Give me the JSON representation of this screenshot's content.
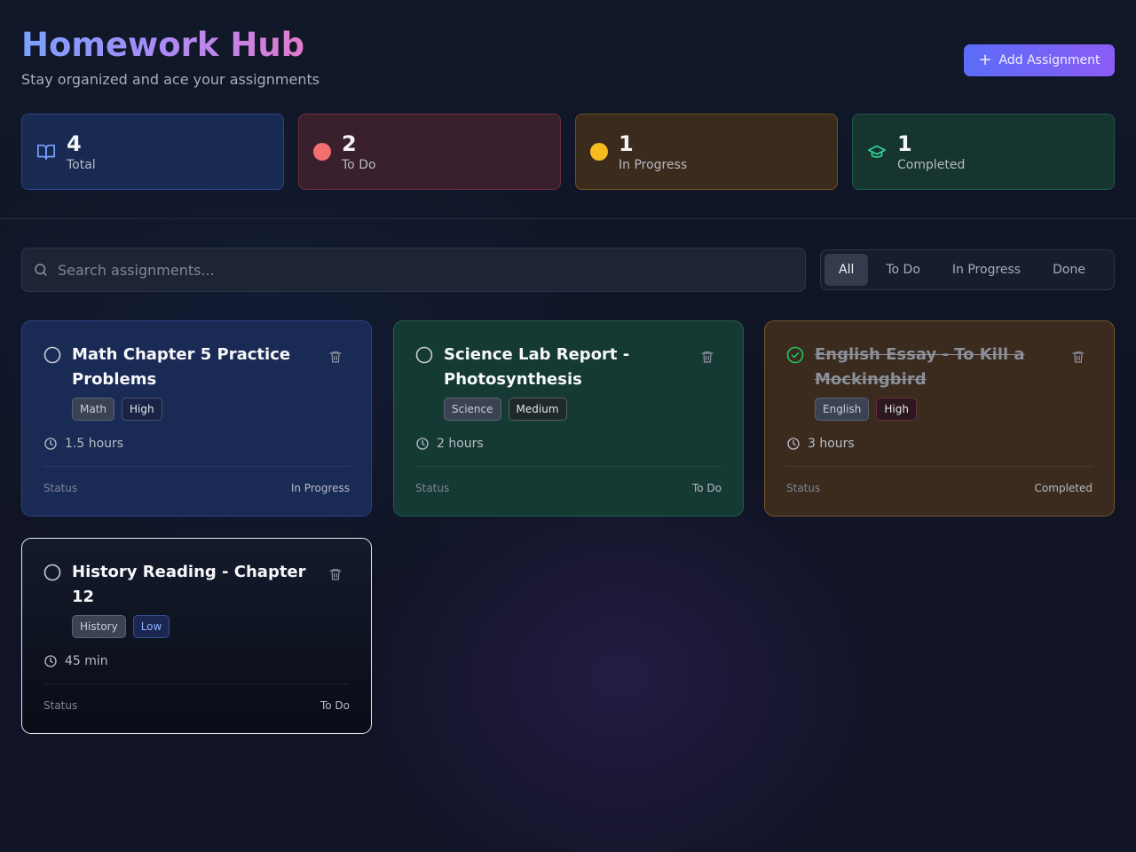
{
  "app": {
    "title": "Homework Hub",
    "subtitle": "Stay organized and ace your assignments",
    "add_button": "Add Assignment"
  },
  "stats": [
    {
      "value": "4",
      "label": "Total",
      "icon": "book-icon"
    },
    {
      "value": "2",
      "label": "To Do",
      "icon": "red-dot",
      "color": "#f16f6f"
    },
    {
      "value": "1",
      "label": "In Progress",
      "icon": "yellow-dot",
      "color": "#f6bc1d"
    },
    {
      "value": "1",
      "label": "Completed",
      "icon": "graduation-cap-icon"
    }
  ],
  "search": {
    "placeholder": "Search assignments..."
  },
  "filters": [
    {
      "label": "All",
      "active": true
    },
    {
      "label": "To Do",
      "active": false
    },
    {
      "label": "In Progress",
      "active": false
    },
    {
      "label": "Done",
      "active": false
    }
  ],
  "assignments": [
    {
      "title": "Math Chapter 5 Practice Problems",
      "subject": "Math",
      "priority": "High",
      "time": "1.5 hours",
      "status_label": "Status",
      "status": "In Progress",
      "done": false
    },
    {
      "title": "Science Lab Report - Photosynthesis",
      "subject": "Science",
      "priority": "Medium",
      "time": "2 hours",
      "status_label": "Status",
      "status": "To Do",
      "done": false
    },
    {
      "title": "English Essay - To Kill a Mockingbird",
      "subject": "English",
      "priority": "High",
      "time": "3 hours",
      "status_label": "Status",
      "status": "Completed",
      "done": true
    },
    {
      "title": "History Reading - Chapter 12",
      "subject": "History",
      "priority": "Low",
      "time": "45 min",
      "status_label": "Status",
      "status": "To Do",
      "done": false
    }
  ],
  "colors": {
    "accent": "#5b6cf6",
    "accent_end": "#8b5cf6",
    "done_green": "#22c55e"
  }
}
